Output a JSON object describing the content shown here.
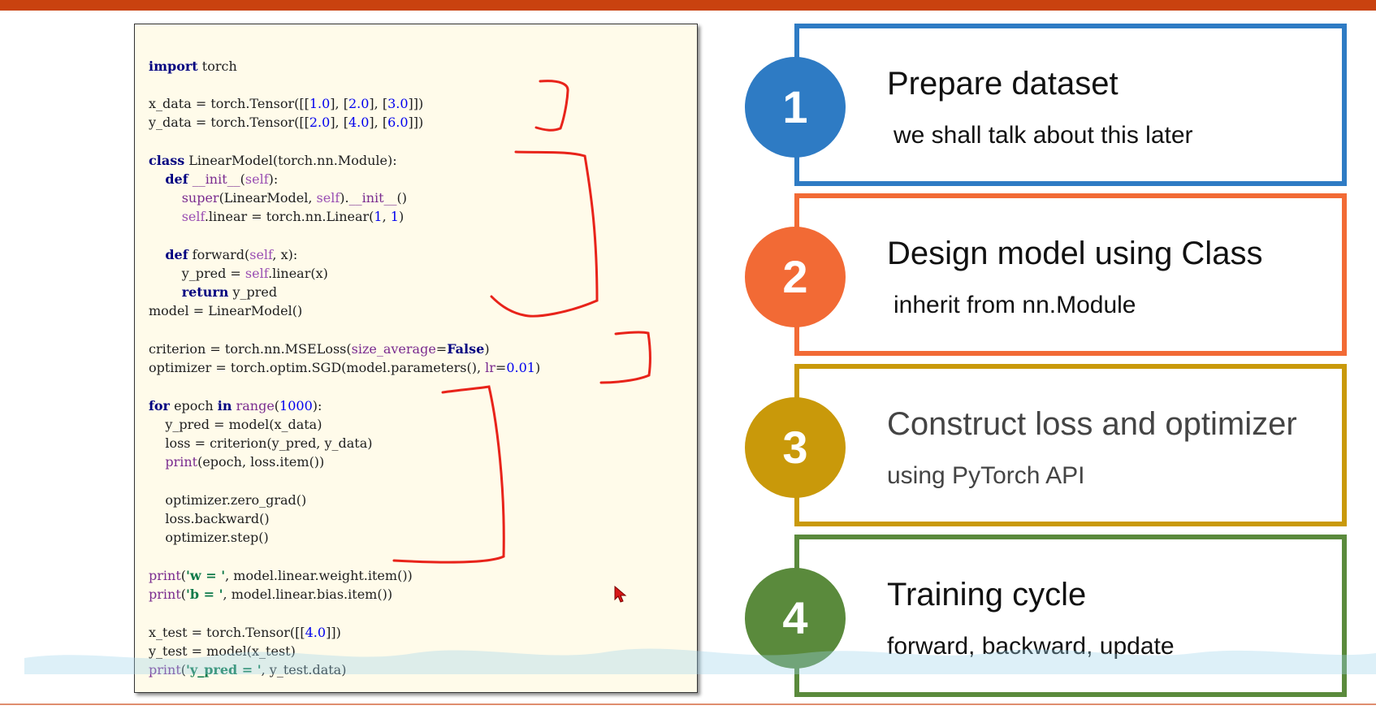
{
  "code": {
    "lines": [
      "import torch",
      "x_data = torch.Tensor([[1.0], [2.0], [3.0]])",
      "y_data = torch.Tensor([[2.0], [4.0], [6.0]])",
      "class LinearModel(torch.nn.Module):",
      "    def __init__(self):",
      "        super(LinearModel, self).__init__()",
      "        self.linear = torch.nn.Linear(1, 1)",
      "    def forward(self, x):",
      "        y_pred = self.linear(x)",
      "        return y_pred",
      "model = LinearModel()",
      "criterion = torch.nn.MSELoss(size_average=False)",
      "optimizer = torch.optim.SGD(model.parameters(), lr=0.01)",
      "for epoch in range(1000):",
      "    y_pred = model(x_data)",
      "    loss = criterion(y_pred, y_data)",
      "    print(epoch, loss.item())",
      "    optimizer.zero_grad()",
      "    loss.backward()",
      "    optimizer.step()",
      "print('w = ', model.linear.weight.item())",
      "print('b = ', model.linear.bias.item())",
      "x_test = torch.Tensor([[4.0]])",
      "y_test = model(x_test)",
      "print('y_pred = ', y_test.data)"
    ]
  },
  "steps": [
    {
      "number": "1",
      "title": "Prepare dataset",
      "subtitle": "we shall talk about this later",
      "color": "#2e7bc4"
    },
    {
      "number": "2",
      "title": "Design model using Class",
      "subtitle": "inherit from nn.Module",
      "color": "#f26a35"
    },
    {
      "number": "3",
      "title": "Construct loss and optimizer",
      "subtitle": "using PyTorch API",
      "color": "#c9990a"
    },
    {
      "number": "4",
      "title": "Training cycle",
      "subtitle": "forward, backward, update",
      "color": "#5a8a3c"
    }
  ],
  "colors": {
    "top_bar": "#c9420f",
    "annotation_red": "#e8231a",
    "code_background": "#fffbea"
  }
}
